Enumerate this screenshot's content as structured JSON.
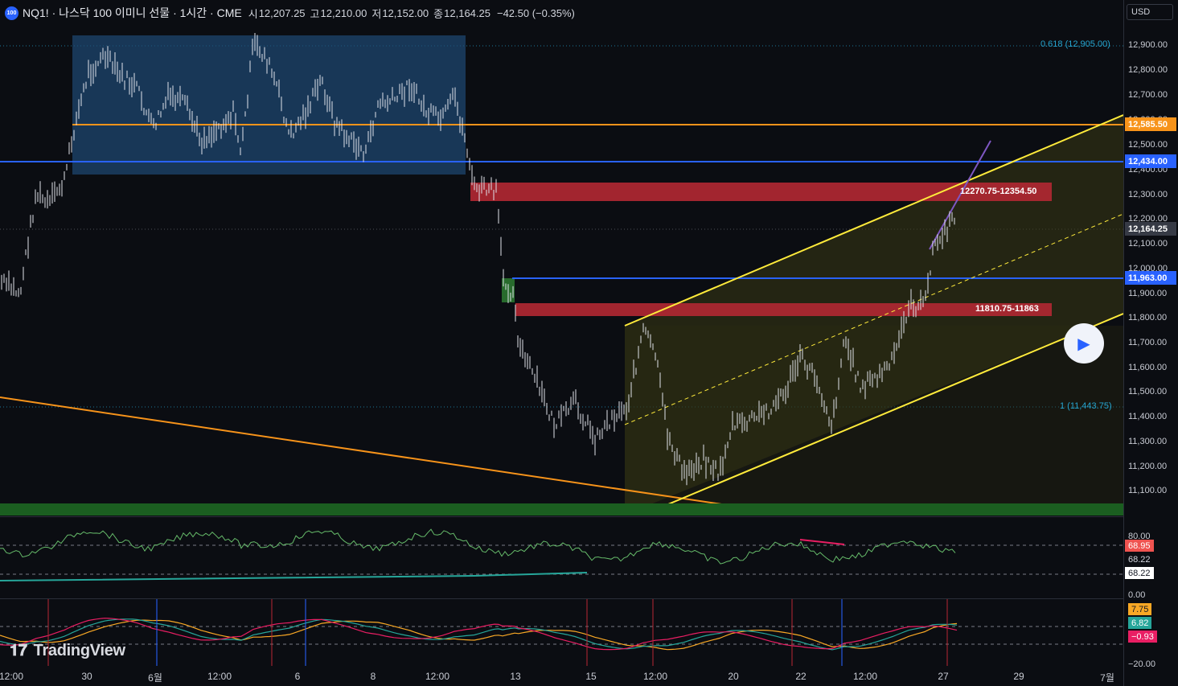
{
  "header": {
    "badge": "100",
    "symbol": "NQ1! · 나스닥 100 이미니 선물 · 1시간 · CME",
    "open_label": "시",
    "open": "12,207.25",
    "high_label": "고",
    "high": "12,210.00",
    "low_label": "저",
    "low": "12,152.00",
    "close_label": "종",
    "close": "12,164.25",
    "change": "−42.50 (−0.35%)"
  },
  "currency": "USD",
  "price_axis": [
    "12,900.00",
    "12,800.00",
    "12,700.00",
    "12,600.00",
    "12,500.00",
    "12,400.00",
    "12,300.00",
    "12,200.00",
    "12,100.00",
    "12,000.00",
    "11,900.00",
    "11,800.00",
    "11,700.00",
    "11,600.00",
    "11,500.00",
    "11,400.00",
    "11,300.00",
    "11,200.00",
    "11,100.00"
  ],
  "price_tags": {
    "orange_level": "12,585.50",
    "blue_upper": "12,434.00",
    "last_price": "12,164.25",
    "blue_lower": "11,963.00"
  },
  "zones": {
    "upper": "12270.75-12354.50",
    "lower": "11810.75-11863"
  },
  "fib": {
    "upper": "0.618 (12,905.00)",
    "lower": "1 (11,443.75)"
  },
  "rsi": {
    "axis_top": "80.00",
    "axis_bottom": "0.00",
    "value1": "68.95",
    "value2": "68.22",
    "value3": "68.22"
  },
  "macd": {
    "axis_bottom": "−20.00",
    "value1": "7.75",
    "value2": "6.82",
    "value3": "−0.93"
  },
  "time_axis": [
    "12:00",
    "30",
    "6월",
    "12:00",
    "6",
    "8",
    "12:00",
    "13",
    "15",
    "12:00",
    "20",
    "22",
    "12:00",
    "27",
    "29",
    "7월"
  ],
  "branding": "TradingView",
  "colors": {
    "orange": "#f7931a",
    "blue": "#2962ff",
    "red_zone": "#b22833",
    "yellow": "#ffeb3b",
    "green": "#1b5e20",
    "teal": "#26a69a"
  }
}
